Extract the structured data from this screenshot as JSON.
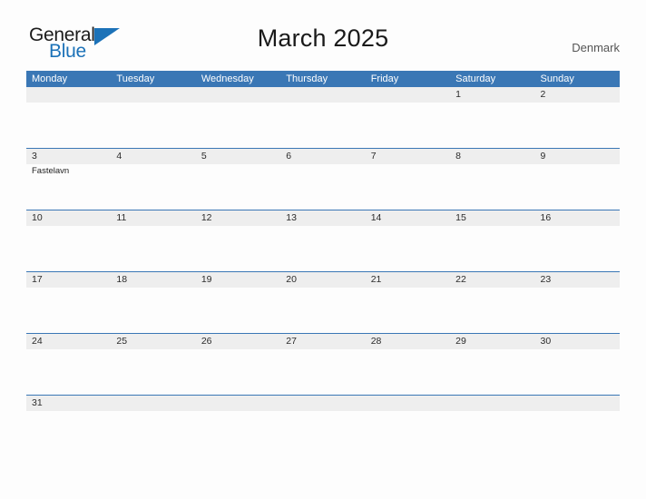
{
  "brand": {
    "line1": "General",
    "line2": "Blue",
    "triangle_color": "#1c72b8",
    "text_color": "#1c1c1c"
  },
  "header": {
    "title": "March 2025",
    "region": "Denmark"
  },
  "theme": {
    "header_blue": "#3a77b5",
    "row_rule": "#3a77b5",
    "date_band": "#eeeeee",
    "page_background": "#fdfdfd"
  },
  "calendar": {
    "weekdays": [
      "Monday",
      "Tuesday",
      "Wednesday",
      "Thursday",
      "Friday",
      "Saturday",
      "Sunday"
    ],
    "weeks": [
      [
        {
          "date": "",
          "events": []
        },
        {
          "date": "",
          "events": []
        },
        {
          "date": "",
          "events": []
        },
        {
          "date": "",
          "events": []
        },
        {
          "date": "",
          "events": []
        },
        {
          "date": "1",
          "events": []
        },
        {
          "date": "2",
          "events": []
        }
      ],
      [
        {
          "date": "3",
          "events": [
            "Fastelavn"
          ]
        },
        {
          "date": "4",
          "events": []
        },
        {
          "date": "5",
          "events": []
        },
        {
          "date": "6",
          "events": []
        },
        {
          "date": "7",
          "events": []
        },
        {
          "date": "8",
          "events": []
        },
        {
          "date": "9",
          "events": []
        }
      ],
      [
        {
          "date": "10",
          "events": []
        },
        {
          "date": "11",
          "events": []
        },
        {
          "date": "12",
          "events": []
        },
        {
          "date": "13",
          "events": []
        },
        {
          "date": "14",
          "events": []
        },
        {
          "date": "15",
          "events": []
        },
        {
          "date": "16",
          "events": []
        }
      ],
      [
        {
          "date": "17",
          "events": []
        },
        {
          "date": "18",
          "events": []
        },
        {
          "date": "19",
          "events": []
        },
        {
          "date": "20",
          "events": []
        },
        {
          "date": "21",
          "events": []
        },
        {
          "date": "22",
          "events": []
        },
        {
          "date": "23",
          "events": []
        }
      ],
      [
        {
          "date": "24",
          "events": []
        },
        {
          "date": "25",
          "events": []
        },
        {
          "date": "26",
          "events": []
        },
        {
          "date": "27",
          "events": []
        },
        {
          "date": "28",
          "events": []
        },
        {
          "date": "29",
          "events": []
        },
        {
          "date": "30",
          "events": []
        }
      ],
      [
        {
          "date": "31",
          "events": []
        },
        {
          "date": "",
          "events": []
        },
        {
          "date": "",
          "events": []
        },
        {
          "date": "",
          "events": []
        },
        {
          "date": "",
          "events": []
        },
        {
          "date": "",
          "events": []
        },
        {
          "date": "",
          "events": []
        }
      ]
    ]
  }
}
